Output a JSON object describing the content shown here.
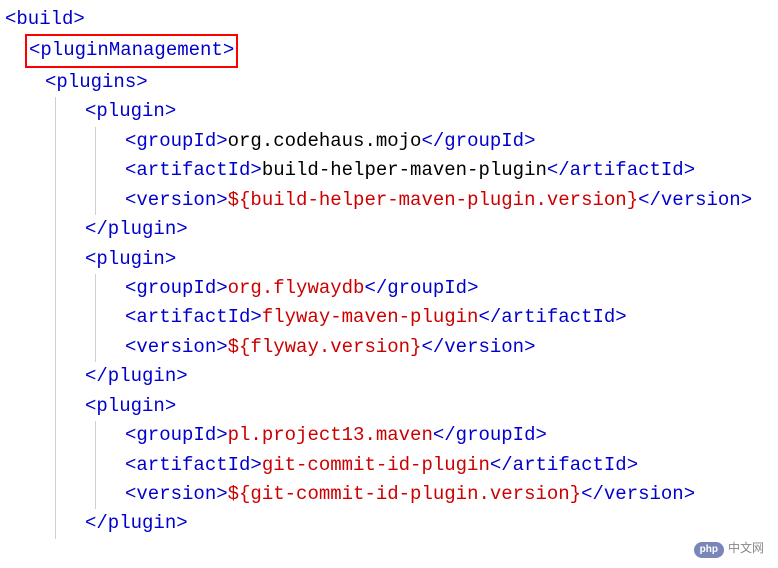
{
  "xml": {
    "build_open": "<build>",
    "pluginManagement_open": "<pluginManagement>",
    "plugins_open": "<plugins>",
    "plugin_open": "<plugin>",
    "plugin_close": "</plugin>",
    "groupId_open": "<groupId>",
    "groupId_close": "</groupId>",
    "artifactId_open": "<artifactId>",
    "artifactId_close": "</artifactId>",
    "version_open": "<version>",
    "version_close": "</version>"
  },
  "plugins": [
    {
      "groupId": "org.codehaus.mojo",
      "artifactId": "build-helper-maven-plugin",
      "version": "${build-helper-maven-plugin.version}"
    },
    {
      "groupId": "org.flywaydb",
      "artifactId": "flyway-maven-plugin",
      "version": "${flyway.version}"
    },
    {
      "groupId": "pl.project13.maven",
      "artifactId": "git-commit-id-plugin",
      "version": "${git-commit-id-plugin.version}"
    }
  ],
  "watermark": {
    "icon": "php",
    "text": "中文网"
  }
}
